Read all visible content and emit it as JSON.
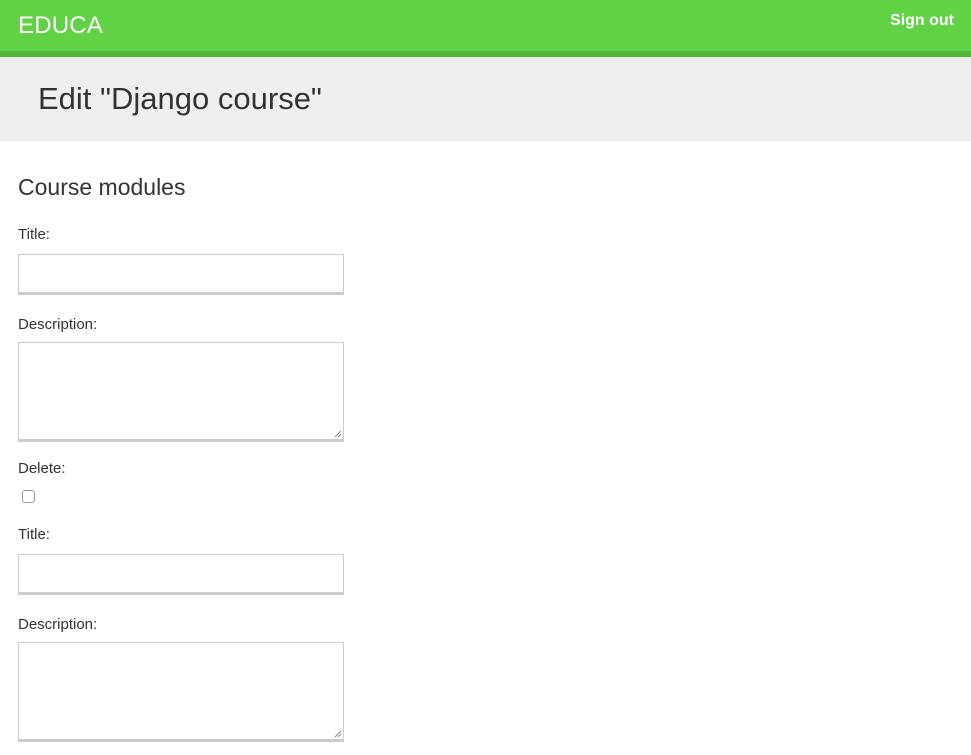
{
  "header": {
    "logo": "EDUCA",
    "signout_label": "Sign out"
  },
  "page": {
    "title": "Edit \"Django course\""
  },
  "form": {
    "section_title": "Course modules",
    "modules": [
      {
        "title_label": "Title:",
        "title_value": "",
        "description_label": "Description:",
        "description_value": "",
        "delete_label": "Delete:",
        "delete_checked": false
      },
      {
        "title_label": "Title:",
        "title_value": "",
        "description_label": "Description:",
        "description_value": ""
      }
    ]
  },
  "colors": {
    "header_bg": "#61d145",
    "header_border": "#52b63a",
    "title_band_bg": "#efefef",
    "text": "#333333"
  },
  "icons": {
    "resize_grip": "resize-grip-icon"
  }
}
